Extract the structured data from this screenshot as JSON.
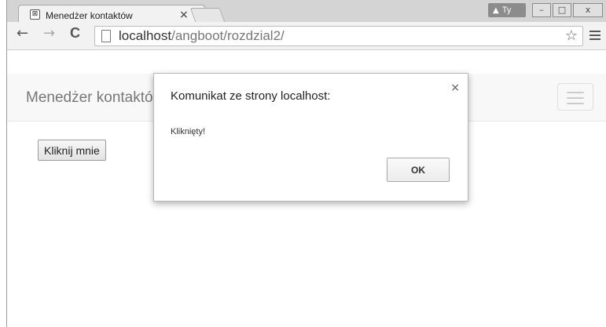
{
  "browser": {
    "tab": {
      "title": "Menedżer kontaktów",
      "favicon": "⊠",
      "close": "×"
    },
    "profile": {
      "warn_icon": "▲",
      "label": "Ty"
    },
    "window_controls": {
      "minimize": "–",
      "maximize": "□",
      "close": "x"
    },
    "nav": {
      "back": "←",
      "forward": "→",
      "reload": "C"
    },
    "address": {
      "host": "localhost",
      "path": "/angboot/rozdzial2/"
    },
    "star": "☆"
  },
  "page": {
    "brand": "Menedżer kontaktów",
    "button_label": "Kliknij mnie"
  },
  "dialog": {
    "title": "Komunikat ze strony localhost:",
    "message": "Kliknięty!",
    "ok_label": "OK",
    "close": "×"
  }
}
